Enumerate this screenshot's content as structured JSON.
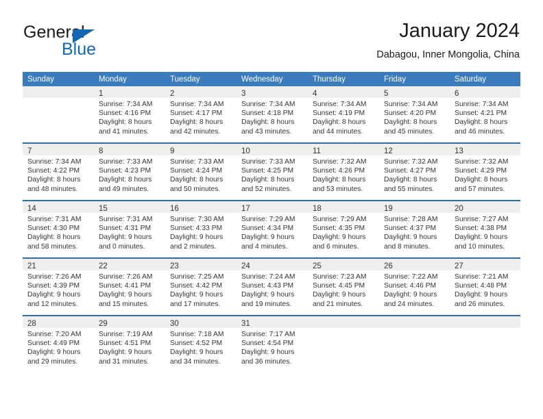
{
  "logo": {
    "word_top": "General",
    "word_bottom": "Blue",
    "accent_color": "#1268b3"
  },
  "header": {
    "title": "January 2024",
    "subtitle": "Dabagou, Inner Mongolia, China"
  },
  "calendar": {
    "header_bg": "#3a7cbe",
    "row_divider_color": "#2e6da4",
    "daynum_bg": "#efefef",
    "weekday_headers": [
      "Sunday",
      "Monday",
      "Tuesday",
      "Wednesday",
      "Thursday",
      "Friday",
      "Saturday"
    ],
    "weeks": [
      [
        {
          "day": "",
          "lines": []
        },
        {
          "day": "1",
          "lines": [
            "Sunrise: 7:34 AM",
            "Sunset: 4:16 PM",
            "Daylight: 8 hours",
            "and 41 minutes."
          ]
        },
        {
          "day": "2",
          "lines": [
            "Sunrise: 7:34 AM",
            "Sunset: 4:17 PM",
            "Daylight: 8 hours",
            "and 42 minutes."
          ]
        },
        {
          "day": "3",
          "lines": [
            "Sunrise: 7:34 AM",
            "Sunset: 4:18 PM",
            "Daylight: 8 hours",
            "and 43 minutes."
          ]
        },
        {
          "day": "4",
          "lines": [
            "Sunrise: 7:34 AM",
            "Sunset: 4:19 PM",
            "Daylight: 8 hours",
            "and 44 minutes."
          ]
        },
        {
          "day": "5",
          "lines": [
            "Sunrise: 7:34 AM",
            "Sunset: 4:20 PM",
            "Daylight: 8 hours",
            "and 45 minutes."
          ]
        },
        {
          "day": "6",
          "lines": [
            "Sunrise: 7:34 AM",
            "Sunset: 4:21 PM",
            "Daylight: 8 hours",
            "and 46 minutes."
          ]
        }
      ],
      [
        {
          "day": "7",
          "lines": [
            "Sunrise: 7:34 AM",
            "Sunset: 4:22 PM",
            "Daylight: 8 hours",
            "and 48 minutes."
          ]
        },
        {
          "day": "8",
          "lines": [
            "Sunrise: 7:33 AM",
            "Sunset: 4:23 PM",
            "Daylight: 8 hours",
            "and 49 minutes."
          ]
        },
        {
          "day": "9",
          "lines": [
            "Sunrise: 7:33 AM",
            "Sunset: 4:24 PM",
            "Daylight: 8 hours",
            "and 50 minutes."
          ]
        },
        {
          "day": "10",
          "lines": [
            "Sunrise: 7:33 AM",
            "Sunset: 4:25 PM",
            "Daylight: 8 hours",
            "and 52 minutes."
          ]
        },
        {
          "day": "11",
          "lines": [
            "Sunrise: 7:32 AM",
            "Sunset: 4:26 PM",
            "Daylight: 8 hours",
            "and 53 minutes."
          ]
        },
        {
          "day": "12",
          "lines": [
            "Sunrise: 7:32 AM",
            "Sunset: 4:27 PM",
            "Daylight: 8 hours",
            "and 55 minutes."
          ]
        },
        {
          "day": "13",
          "lines": [
            "Sunrise: 7:32 AM",
            "Sunset: 4:29 PM",
            "Daylight: 8 hours",
            "and 57 minutes."
          ]
        }
      ],
      [
        {
          "day": "14",
          "lines": [
            "Sunrise: 7:31 AM",
            "Sunset: 4:30 PM",
            "Daylight: 8 hours",
            "and 58 minutes."
          ]
        },
        {
          "day": "15",
          "lines": [
            "Sunrise: 7:31 AM",
            "Sunset: 4:31 PM",
            "Daylight: 9 hours",
            "and 0 minutes."
          ]
        },
        {
          "day": "16",
          "lines": [
            "Sunrise: 7:30 AM",
            "Sunset: 4:33 PM",
            "Daylight: 9 hours",
            "and 2 minutes."
          ]
        },
        {
          "day": "17",
          "lines": [
            "Sunrise: 7:29 AM",
            "Sunset: 4:34 PM",
            "Daylight: 9 hours",
            "and 4 minutes."
          ]
        },
        {
          "day": "18",
          "lines": [
            "Sunrise: 7:29 AM",
            "Sunset: 4:35 PM",
            "Daylight: 9 hours",
            "and 6 minutes."
          ]
        },
        {
          "day": "19",
          "lines": [
            "Sunrise: 7:28 AM",
            "Sunset: 4:37 PM",
            "Daylight: 9 hours",
            "and 8 minutes."
          ]
        },
        {
          "day": "20",
          "lines": [
            "Sunrise: 7:27 AM",
            "Sunset: 4:38 PM",
            "Daylight: 9 hours",
            "and 10 minutes."
          ]
        }
      ],
      [
        {
          "day": "21",
          "lines": [
            "Sunrise: 7:26 AM",
            "Sunset: 4:39 PM",
            "Daylight: 9 hours",
            "and 12 minutes."
          ]
        },
        {
          "day": "22",
          "lines": [
            "Sunrise: 7:26 AM",
            "Sunset: 4:41 PM",
            "Daylight: 9 hours",
            "and 15 minutes."
          ]
        },
        {
          "day": "23",
          "lines": [
            "Sunrise: 7:25 AM",
            "Sunset: 4:42 PM",
            "Daylight: 9 hours",
            "and 17 minutes."
          ]
        },
        {
          "day": "24",
          "lines": [
            "Sunrise: 7:24 AM",
            "Sunset: 4:43 PM",
            "Daylight: 9 hours",
            "and 19 minutes."
          ]
        },
        {
          "day": "25",
          "lines": [
            "Sunrise: 7:23 AM",
            "Sunset: 4:45 PM",
            "Daylight: 9 hours",
            "and 21 minutes."
          ]
        },
        {
          "day": "26",
          "lines": [
            "Sunrise: 7:22 AM",
            "Sunset: 4:46 PM",
            "Daylight: 9 hours",
            "and 24 minutes."
          ]
        },
        {
          "day": "27",
          "lines": [
            "Sunrise: 7:21 AM",
            "Sunset: 4:48 PM",
            "Daylight: 9 hours",
            "and 26 minutes."
          ]
        }
      ],
      [
        {
          "day": "28",
          "lines": [
            "Sunrise: 7:20 AM",
            "Sunset: 4:49 PM",
            "Daylight: 9 hours",
            "and 29 minutes."
          ]
        },
        {
          "day": "29",
          "lines": [
            "Sunrise: 7:19 AM",
            "Sunset: 4:51 PM",
            "Daylight: 9 hours",
            "and 31 minutes."
          ]
        },
        {
          "day": "30",
          "lines": [
            "Sunrise: 7:18 AM",
            "Sunset: 4:52 PM",
            "Daylight: 9 hours",
            "and 34 minutes."
          ]
        },
        {
          "day": "31",
          "lines": [
            "Sunrise: 7:17 AM",
            "Sunset: 4:54 PM",
            "Daylight: 9 hours",
            "and 36 minutes."
          ]
        },
        {
          "day": "",
          "lines": []
        },
        {
          "day": "",
          "lines": []
        },
        {
          "day": "",
          "lines": []
        }
      ]
    ]
  }
}
